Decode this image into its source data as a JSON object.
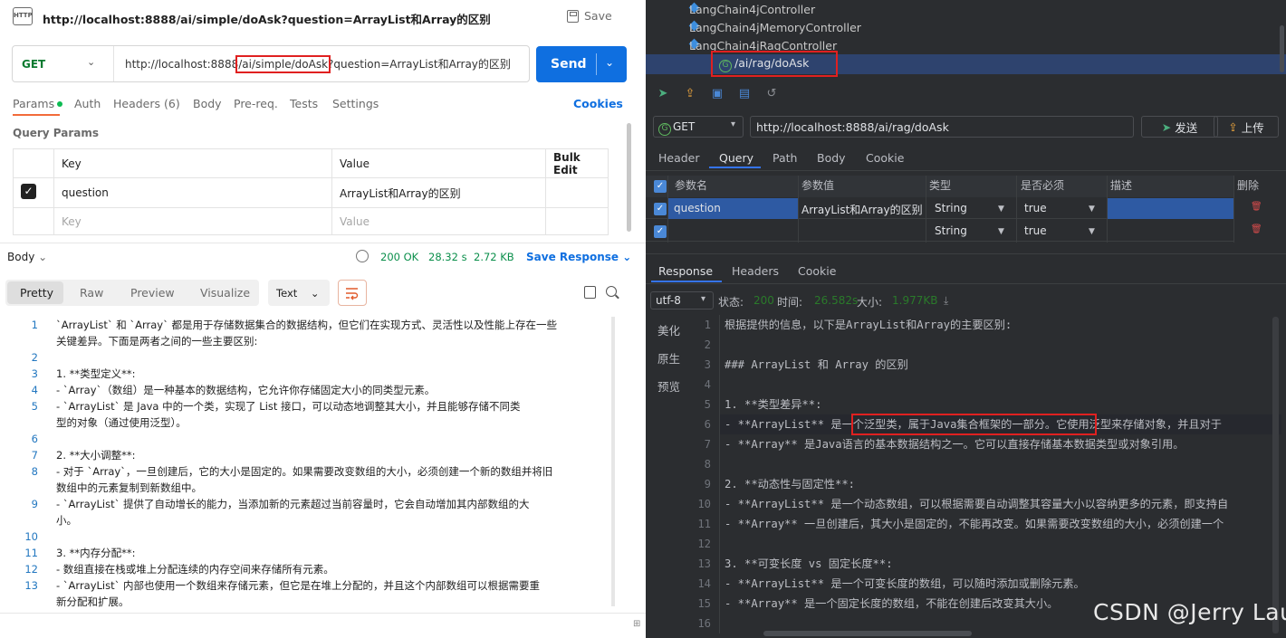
{
  "left": {
    "title": "http://localhost:8888/ai/simple/doAsk?question=ArrayList和Array的区别",
    "save_label": "Save",
    "method": "GET",
    "url_prefix": "http://localhost:8888",
    "url_path": "/ai/simple/doAsk",
    "url_query": "?question=ArrayList和Array的区别",
    "send_label": "Send",
    "tabs": [
      "Params",
      "Auth",
      "Headers (6)",
      "Body",
      "Pre-req.",
      "Tests",
      "Settings"
    ],
    "cookies_label": "Cookies",
    "query_params_title": "Query Params",
    "table": {
      "headers": [
        "Key",
        "Value",
        "Bulk Edit"
      ],
      "row": {
        "key": "question",
        "value": "ArrayList和Array的区别"
      },
      "placeholder_key": "Key",
      "placeholder_value": "Value"
    },
    "response": {
      "body_label": "Body",
      "status": "200 OK",
      "time": "28.32 s",
      "size": "2.72 KB",
      "save_response": "Save Response",
      "view_tabs": [
        "Pretty",
        "Raw",
        "Preview",
        "Visualize"
      ],
      "format": "Text",
      "lines": [
        {
          "n": "1",
          "t": "`ArrayList` 和 `Array` 都是用于存储数据集合的数据结构，但它们在实现方式、灵活性以及性能上存在一些"
        },
        {
          "n": "",
          "t": "    关键差异。下面是两者之间的一些主要区别:"
        },
        {
          "n": "2",
          "t": ""
        },
        {
          "n": "3",
          "t": "1. **类型定义**:"
        },
        {
          "n": "4",
          "t": "   - `Array`（数组）是一种基本的数据结构，它允许你存储固定大小的同类型元素。"
        },
        {
          "n": "5",
          "t": "   - `ArrayList` 是 Java 中的一个类，实现了 List 接口，可以动态地调整其大小，并且能够存储不同类"
        },
        {
          "n": "",
          "t": "     型的对象（通过使用泛型）。"
        },
        {
          "n": "6",
          "t": ""
        },
        {
          "n": "7",
          "t": "2. **大小调整**:"
        },
        {
          "n": "8",
          "t": "   - 对于 `Array`，一旦创建后，它的大小是固定的。如果需要改变数组的大小，必须创建一个新的数组并将旧"
        },
        {
          "n": "",
          "t": "     数组中的元素复制到新数组中。"
        },
        {
          "n": "9",
          "t": "   - `ArrayList` 提供了自动增长的能力，当添加新的元素超过当前容量时，它会自动增加其内部数组的大"
        },
        {
          "n": "",
          "t": "     小。"
        },
        {
          "n": "10",
          "t": ""
        },
        {
          "n": "11",
          "t": "3. **内存分配**:"
        },
        {
          "n": "12",
          "t": "   - 数组直接在栈或堆上分配连续的内存空间来存储所有元素。"
        },
        {
          "n": "13",
          "t": "   - `ArrayList` 内部也使用一个数组来存储元素，但它是在堆上分配的，并且这个内部数组可以根据需要重"
        },
        {
          "n": "",
          "t": "     新分配和扩展。"
        }
      ]
    }
  },
  "right": {
    "tree": [
      {
        "label": "LangChain4jController"
      },
      {
        "label": "LangChain4jMemoryController"
      },
      {
        "label": "LangChain4jRagController"
      }
    ],
    "selected_endpoint": "/ai/rag/doAsk",
    "method": "GET",
    "url": "http://localhost:8888/ai/rag/doAsk",
    "send_label": "发送",
    "upload_label": "上传",
    "tabs": [
      "Header",
      "Query",
      "Path",
      "Body",
      "Cookie"
    ],
    "grid_headers": [
      "参数名",
      "参数值",
      "类型",
      "是否必须",
      "描述",
      "删除"
    ],
    "grid_row": {
      "name": "question",
      "value": "ArrayList和Array的区别",
      "type": "String",
      "required": "true"
    },
    "grid_row2": {
      "type": "String",
      "required": "true"
    },
    "response_tabs": [
      "Response",
      "Headers",
      "Cookie"
    ],
    "encoding": "utf-8",
    "status_label": "状态:",
    "status_value": "200",
    "time_label": "时间:",
    "time_value": "26.582s",
    "size_label": "大小:",
    "size_value": "1.977KB",
    "side_tabs": [
      "美化",
      "原生",
      "预览"
    ],
    "lines": [
      {
        "n": "1",
        "t": "根据提供的信息，以下是ArrayList和Array的主要区别:"
      },
      {
        "n": "2",
        "t": ""
      },
      {
        "n": "3",
        "t": "### ArrayList 和 Array 的区别"
      },
      {
        "n": "4",
        "t": ""
      },
      {
        "n": "5",
        "t": "1. **类型差异**:"
      },
      {
        "n": "6",
        "t": "   - **ArrayList** 是一个泛型类，属于Java集合框架的一部分。它使用泛型来存储对象，并且对于"
      },
      {
        "n": "7",
        "t": "   - **Array** 是Java语言的基本数据结构之一。它可以直接存储基本数据类型或对象引用。"
      },
      {
        "n": "8",
        "t": ""
      },
      {
        "n": "9",
        "t": "2. **动态性与固定性**:"
      },
      {
        "n": "10",
        "t": "   - **ArrayList** 是一个动态数组，可以根据需要自动调整其容量大小以容纳更多的元素，即支持自"
      },
      {
        "n": "11",
        "t": "   - **Array** 一旦创建后，其大小是固定的，不能再改变。如果需要改变数组的大小，必须创建一个"
      },
      {
        "n": "12",
        "t": ""
      },
      {
        "n": "13",
        "t": "3. **可变长度 vs 固定长度**:"
      },
      {
        "n": "14",
        "t": "   - **ArrayList** 是一个可变长度的数组，可以随时添加或删除元素。"
      },
      {
        "n": "15",
        "t": "   - **Array** 是一个固定长度的数组，不能在创建后改变其大小。"
      },
      {
        "n": "16",
        "t": ""
      }
    ],
    "watermark": "CSDN @Jerry Lau"
  },
  "colors": {
    "send_blue": "#0f6fe0",
    "status_green": "#0b8f4b",
    "highlight_red": "#e02020",
    "dark_bg": "#2b2d30"
  }
}
